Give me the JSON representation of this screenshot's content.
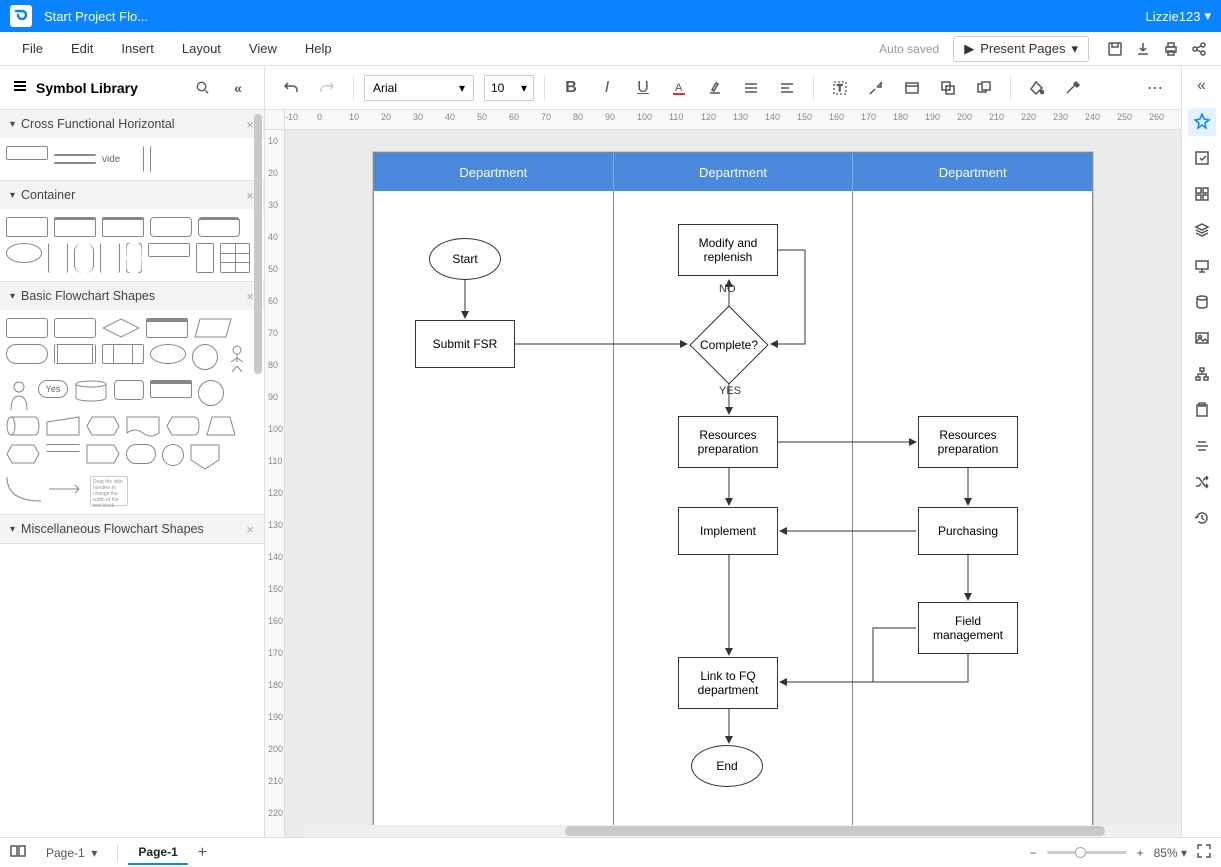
{
  "titlebar": {
    "app_name": "Start Project Flo...",
    "user": "Lizzie123"
  },
  "menu": {
    "file": "File",
    "edit": "Edit",
    "insert": "Insert",
    "layout": "Layout",
    "view": "View",
    "help": "Help"
  },
  "actions": {
    "autosaved": "Auto saved",
    "present": "Present Pages"
  },
  "sidebar": {
    "title": "Symbol Library",
    "sections": {
      "cross": "Cross Functional Horizontal",
      "container": "Container",
      "basic": "Basic Flowchart Shapes",
      "misc": "Miscellaneous Flowchart Shapes"
    },
    "vide": "vide"
  },
  "toolbar": {
    "font": "Arial",
    "size": "10"
  },
  "ruler_h": [
    "-10",
    "0",
    "10",
    "20",
    "30",
    "40",
    "50",
    "60",
    "70",
    "80",
    "90",
    "100",
    "110",
    "120",
    "130",
    "140",
    "150",
    "160",
    "170",
    "180",
    "190",
    "200",
    "210",
    "220",
    "230",
    "240",
    "250",
    "260"
  ],
  "ruler_v": [
    "10",
    "20",
    "30",
    "40",
    "50",
    "60",
    "70",
    "80",
    "90",
    "100",
    "110",
    "120",
    "130",
    "140",
    "150",
    "160",
    "170",
    "180",
    "190",
    "200",
    "210",
    "220"
  ],
  "swimlanes": {
    "col1": "Department",
    "col2": "Department",
    "col3": "Department"
  },
  "nodes": {
    "start": "Start",
    "submit": "Submit FSR",
    "modify": "Modify and replenish",
    "complete": "Complete?",
    "no": "NO",
    "yes": "YES",
    "res1": "Resources preparation",
    "res2": "Resources preparation",
    "impl": "Implement",
    "purch": "Purchasing",
    "field": "Field management",
    "link": "Link to FQ department",
    "end": "End"
  },
  "shapes_text": {
    "yes": "Yes"
  },
  "status": {
    "page_dropdown": "Page-1",
    "page_tab": "Page-1",
    "zoom": "85%"
  }
}
